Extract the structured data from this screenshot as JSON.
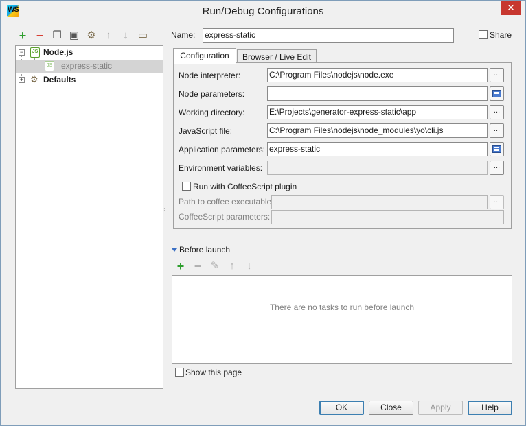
{
  "window": {
    "title": "Run/Debug Configurations",
    "logo_text": "WS"
  },
  "toolbar": {
    "buttons": [
      {
        "icon": "add-icon",
        "glyph": "+",
        "color": "#2e9e2e"
      },
      {
        "icon": "remove-icon",
        "glyph": "−",
        "color": "#d63a2f"
      },
      {
        "icon": "copy-icon",
        "glyph": "❐",
        "color": "#555555"
      },
      {
        "icon": "save-icon",
        "glyph": "🖫",
        "color": "#555555"
      },
      {
        "icon": "edit-defaults-icon",
        "glyph": "⚙",
        "color": "#7a6a4a"
      },
      {
        "icon": "move-up-icon",
        "glyph": "⬆",
        "color": "#9a9a9a"
      },
      {
        "icon": "move-down-icon",
        "glyph": "⬇",
        "color": "#9a9a9a"
      },
      {
        "icon": "folder-icon",
        "glyph": "🗀",
        "color": "#7a6a4a"
      }
    ]
  },
  "tree": {
    "root": "Node.js",
    "child": "express-static",
    "defaults": "Defaults",
    "node_icon_text": "JS"
  },
  "name": {
    "label": "Name:",
    "value": "express-static"
  },
  "share": {
    "label": "Share"
  },
  "tabs": [
    {
      "label": "Configuration"
    },
    {
      "label": "Browser / Live Edit"
    }
  ],
  "config": {
    "node_interpreter": {
      "label": "Node interpreter:",
      "value": "C:\\Program Files\\nodejs\\node.exe"
    },
    "node_parameters": {
      "label": "Node parameters:",
      "value": ""
    },
    "working_directory": {
      "label": "Working directory:",
      "value": "E:\\Projects\\generator-express-static\\app"
    },
    "javascript_file": {
      "label": "JavaScript file:",
      "value": "C:\\Program Files\\nodejs\\node_modules\\yo\\cli.js"
    },
    "application_parameters": {
      "label": "Application parameters:",
      "value": "express-static"
    },
    "environment_variables": {
      "label": "Environment variables:",
      "value": ""
    },
    "coffeescript": {
      "label": "Run with CoffeeScript plugin"
    },
    "coffee_path": {
      "label": "Path to coffee executable:",
      "value": ""
    },
    "coffee_params": {
      "label": "CoffeeScript parameters:",
      "value": ""
    },
    "browse_glyph": "..."
  },
  "before_launch": {
    "title": "Before launch",
    "empty_message": "There are no tasks to run before launch",
    "show_page": "Show this page"
  },
  "buttons": {
    "ok": "OK",
    "close": "Close",
    "apply": "Apply",
    "help": "Help"
  }
}
